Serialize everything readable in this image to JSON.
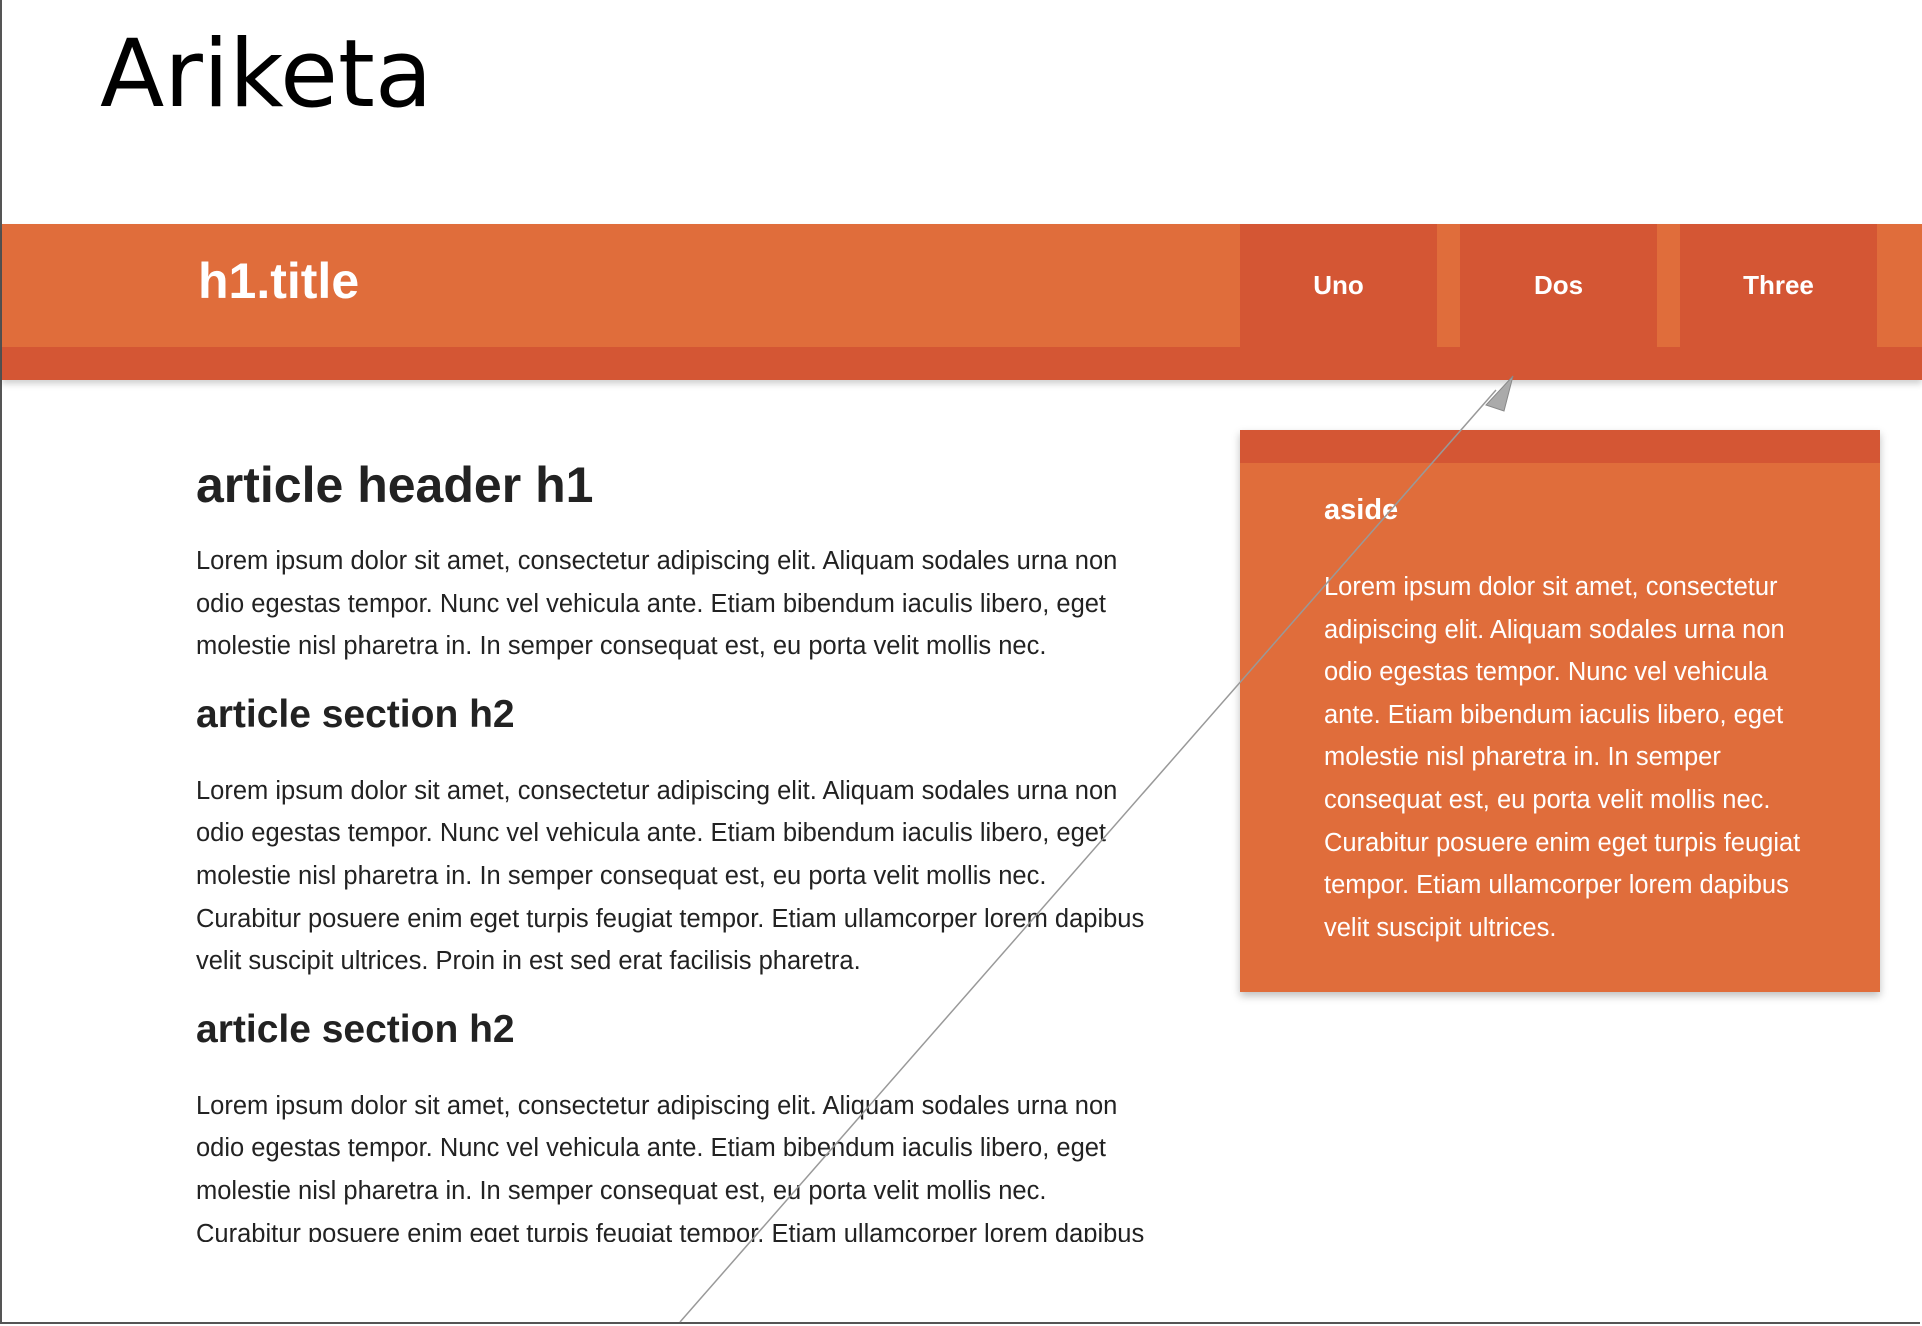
{
  "slide": {
    "title": "Ariketa"
  },
  "header": {
    "title": "h1.title",
    "nav": [
      "Uno",
      "Dos",
      "Three"
    ]
  },
  "article": {
    "h1": "article header h1",
    "p1": "Lorem ipsum dolor sit amet, consectetur adipiscing elit. Aliquam sodales urna non odio egestas tempor. Nunc vel vehicula ante. Etiam bibendum iaculis libero, eget molestie nisl pharetra in. In semper consequat est, eu porta velit mollis nec.",
    "sections": [
      {
        "h2": "article section h2",
        "p": "Lorem ipsum dolor sit amet, consectetur adipiscing elit. Aliquam sodales urna non odio egestas tempor. Nunc vel vehicula ante. Etiam bibendum iaculis libero, eget molestie nisl pharetra in. In semper consequat est, eu porta velit mollis nec. Curabitur posuere enim eget turpis feugiat tempor. Etiam ullamcorper lorem dapibus velit suscipit ultrices. Proin in est sed erat facilisis pharetra."
      },
      {
        "h2": "article section h2",
        "p": "Lorem ipsum dolor sit amet, consectetur adipiscing elit. Aliquam sodales urna non odio egestas tempor. Nunc vel vehicula ante. Etiam bibendum iaculis libero, eget molestie nisl pharetra in. In semper consequat est, eu porta velit mollis nec. Curabitur posuere enim eget turpis feugiat tempor. Etiam ullamcorper lorem dapibus velit suscipit ultrices."
      }
    ]
  },
  "aside": {
    "title": "aside",
    "text": "Lorem ipsum dolor sit amet, consectetur adipiscing elit. Aliquam sodales urna non odio egestas tempor. Nunc vel vehicula ante. Etiam bibendum iaculis libero, eget molestie nisl pharetra in. In semper consequat est, eu porta velit mollis nec. Curabitur posuere enim eget turpis feugiat tempor. Etiam ullamcorper lorem dapibus velit suscipit ultrices."
  },
  "colors": {
    "primary": "#e06d3b",
    "primary_dark": "#d45634",
    "text": "#222222",
    "arrow": "#999999"
  },
  "icons": {
    "arrow": "arrow-icon"
  }
}
